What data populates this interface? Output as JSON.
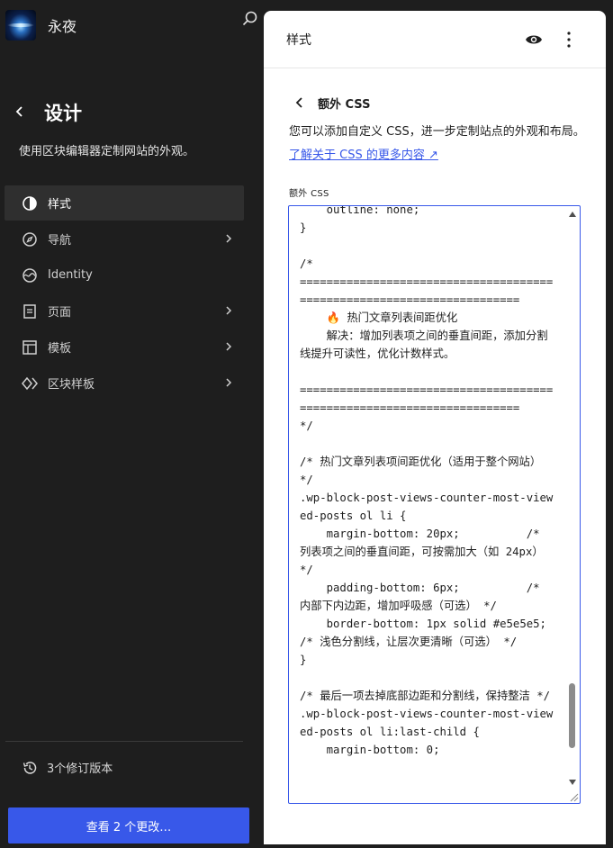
{
  "site": {
    "name": "永夜",
    "logo_icon": "site-logo"
  },
  "sidebar": {
    "title": "设计",
    "description": "使用区块编辑器定制网站的外观。",
    "items": [
      {
        "label": "样式",
        "icon": "half-circle-icon",
        "active": true,
        "chevron": false
      },
      {
        "label": "导航",
        "icon": "compass-icon",
        "active": false,
        "chevron": true
      },
      {
        "label": "Identity",
        "icon": "identity-icon",
        "active": false,
        "chevron": false
      },
      {
        "label": "页面",
        "icon": "page-icon",
        "active": false,
        "chevron": true
      },
      {
        "label": "模板",
        "icon": "layout-icon",
        "active": false,
        "chevron": true
      },
      {
        "label": "区块样板",
        "icon": "symbol-icon",
        "active": false,
        "chevron": true
      }
    ],
    "revisions": "3个修订版本",
    "save_button": "查看 2 个更改…"
  },
  "panel": {
    "title": "样式",
    "sub_title": "额外 CSS",
    "description": "您可以添加自定义 CSS，进一步定制站点的外观和布局。",
    "link": "了解关于 CSS 的更多内容 ↗",
    "field_label": "额外 CSS",
    "css_content": "    outline: none;\n}\n\n/*\n=======================================================================\n    🔥 热门文章列表间距优化\n    解决：增加列表项之间的垂直间距，添加分割线提升可读性，优化计数样式。\n\n=======================================================================\n*/\n\n/* 热门文章列表项间距优化（适用于整个网站） */\n.wp-block-post-views-counter-most-viewed-posts ol li {\n    margin-bottom: 20px;          /* 列表项之间的垂直间距，可按需加大（如 24px） */\n    padding-bottom: 6px;          /* 内部下内边距，增加呼吸感（可选） */\n    border-bottom: 1px solid #e5e5e5; /* 浅色分割线，让层次更清晰（可选） */\n}\n\n/* 最后一项去掉底部边距和分割线，保持整洁 */\n.wp-block-post-views-counter-most-viewed-posts ol li:last-child {\n    margin-bottom: 0;"
  },
  "colors": {
    "accent": "#3858e9",
    "sidebar_bg": "#1e1e1e",
    "active_item_bg": "#2f2f2f"
  }
}
